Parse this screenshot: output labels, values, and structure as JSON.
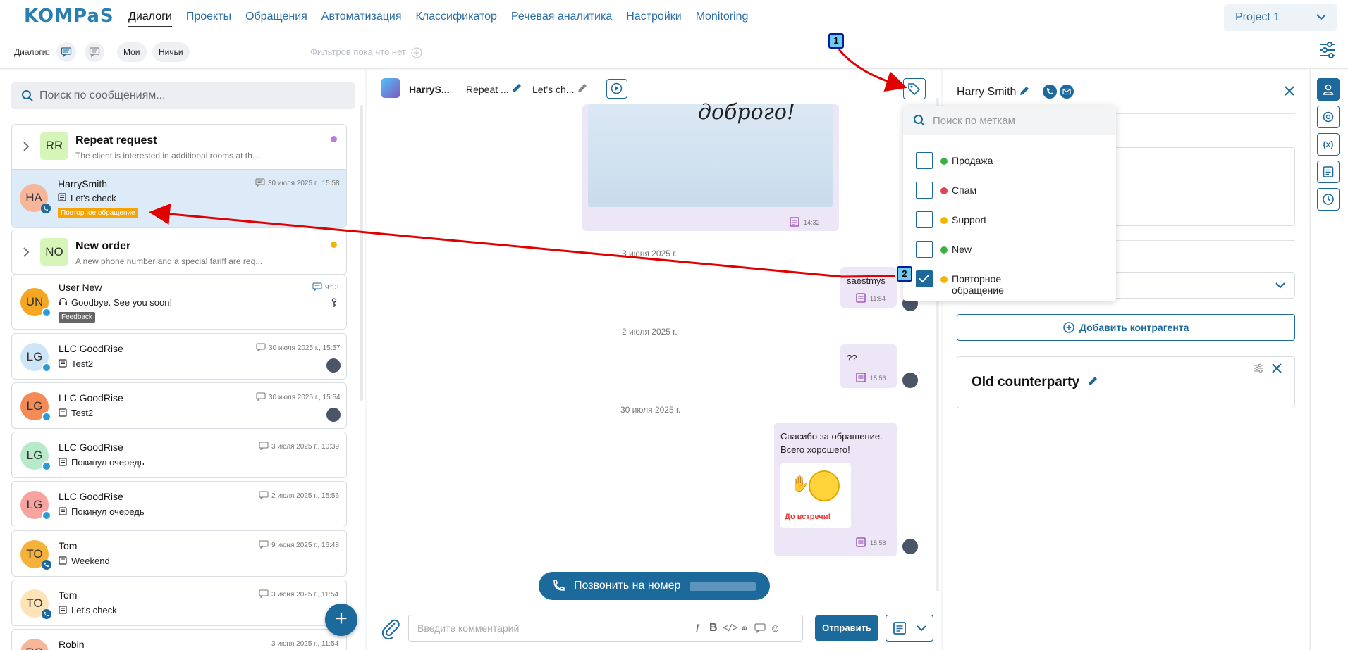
{
  "topnav": {
    "logo": "KOMPaS",
    "logo_sub": "",
    "menu": [
      "Диалоги",
      "Проекты",
      "Обращения",
      "Автоматизация",
      "Классификатор",
      "Речевая аналитика",
      "Настройки",
      "Monitoring"
    ],
    "project": "Project 1"
  },
  "filterbar": {
    "label": "Диалоги:",
    "chips": [
      "Мои",
      "Ничьи"
    ],
    "no_filters": "Фильтров пока что нет"
  },
  "search": {
    "placeholder": "Поиск по сообщениям..."
  },
  "dialogs": [
    {
      "initials": "RR",
      "title": "Repeat request",
      "subtitle": "The client is interested in additional rooms at th...",
      "dot": "#b67ee0"
    },
    {
      "initials": "HA",
      "title": "HarrySmith",
      "message": "Let's check",
      "time": "30 июля 2025 г., 15:58",
      "badge": "Повторное обращение"
    },
    {
      "initials": "NO",
      "title": "New order",
      "subtitle": "A new phone number and a special tariff are req...",
      "dot": "#f5b400"
    },
    {
      "initials": "UN",
      "title": "User New",
      "message": "Goodbye. See you soon!",
      "time": "9:13",
      "badge": "Feedback"
    },
    {
      "initials": "LG",
      "title": "LLC GoodRise",
      "message": "Test2",
      "time": "30 июля 2025 г., 15:57"
    },
    {
      "initials": "LG",
      "title": "LLC GoodRise",
      "message": "Test2",
      "time": "30 июля 2025 г., 15:54"
    },
    {
      "initials": "LG",
      "title": "LLC GoodRise",
      "message": "Покинул очередь",
      "time": "3 июля 2025 г., 10:39"
    },
    {
      "initials": "LG",
      "title": "LLC GoodRise",
      "message": "Покинул очередь",
      "time": "2 июля 2025 г., 15:56"
    },
    {
      "initials": "TO",
      "title": "Tom",
      "message": "Weekend",
      "time": "9 июня 2025 г., 16:48"
    },
    {
      "initials": "TO",
      "title": "Tom",
      "message": "Let's check",
      "time": "3 июня 2025 г., 11:54"
    },
    {
      "initials": "RO",
      "title": "Robin",
      "message": "",
      "time": "3 июня 2025 г., 11:54"
    }
  ],
  "chat": {
    "header": {
      "name": "HarryS...",
      "topic": "Repeat ...",
      "last": "Let's ch..."
    },
    "image_caption": "доброго!",
    "msgs": [
      {
        "time": "14:32"
      },
      {
        "date": "3 июня 2025 г.",
        "text": "saestmys",
        "time": "11:54"
      },
      {
        "date": "2 июля 2025 г.",
        "text": "??",
        "time": "15:56"
      },
      {
        "date": "30 июля 2025 г.",
        "text1": "Спасибо за обращение.",
        "text2": "Всего хорошего!",
        "sticker": "До встречи!",
        "time": "15:58"
      }
    ],
    "call_button": "Позвонить на номер",
    "composer_placeholder": "Введите комментарий",
    "send": "Отправить"
  },
  "tags": {
    "search_placeholder": "Поиск по меткам",
    "items": [
      {
        "label": "Продажа",
        "color": "#3cb043",
        "checked": false
      },
      {
        "label": "Спам",
        "color": "#e0474c",
        "checked": false
      },
      {
        "label": "Support",
        "color": "#f5b400",
        "checked": false
      },
      {
        "label": "New",
        "color": "#3cb043",
        "checked": false
      },
      {
        "label": "Повторное обращение",
        "color": "#f5b400",
        "checked": true
      }
    ]
  },
  "contact": {
    "name": "Harry Smith",
    "add_counterparty": "Добавить контрагента",
    "counterparty": "Old counterparty"
  },
  "markers": [
    "1",
    "2"
  ]
}
